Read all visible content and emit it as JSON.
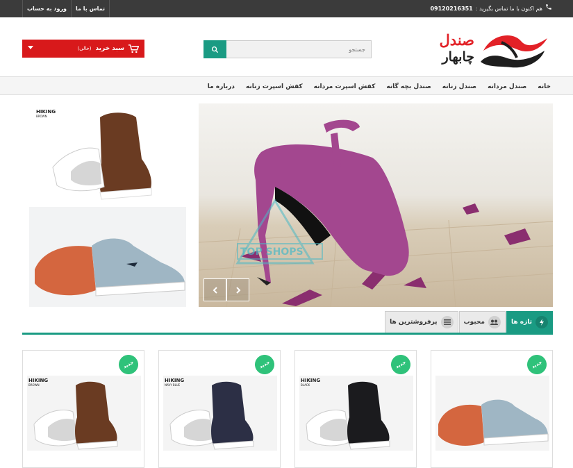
{
  "topbar": {
    "links": [
      "ورود به حساب",
      "تماس با ما"
    ],
    "phone_label": "هم اکنون با ما تماس بگیرید :",
    "phone_number": "09120216351"
  },
  "logo": {
    "line1": "صندل",
    "line2": "چابهار"
  },
  "search": {
    "placeholder": "جستجو"
  },
  "cart": {
    "label": "سبد خرید",
    "status": "(خالی)"
  },
  "nav": [
    "خانه",
    "صندل مردانه",
    "صندل زنانه",
    "صندل بچه گانه",
    "کفش اسپرت مردانه",
    "کفش اسپرت زنانه",
    "درباره ما"
  ],
  "slider": {
    "watermark": "TOP SHOPS"
  },
  "side_banners": [
    {
      "brand": "HIKING",
      "color": "BROWN"
    }
  ],
  "tabs": [
    {
      "label": "تازه ها",
      "icon": "bolt-icon",
      "active": true
    },
    {
      "label": "محبوب",
      "icon": "users-icon",
      "active": false
    },
    {
      "label": "پرفروشترین ها",
      "icon": "list-icon",
      "active": false
    }
  ],
  "products": [
    {
      "badge": "جدید",
      "brand": "",
      "color": "",
      "shoe": "#9fb6c4",
      "sole": "#d4663f"
    },
    {
      "badge": "جدید",
      "brand": "HIKING",
      "color": "BLACK",
      "shoe": "#1b1b1e",
      "sole": "#ffffff"
    },
    {
      "badge": "جدید",
      "brand": "HIKING",
      "color": "NAVY BLUE",
      "shoe": "#2c2f45",
      "sole": "#ffffff"
    },
    {
      "badge": "جدید",
      "brand": "HIKING",
      "color": "BROWN",
      "shoe": "#6a3b22",
      "sole": "#ffffff"
    }
  ]
}
